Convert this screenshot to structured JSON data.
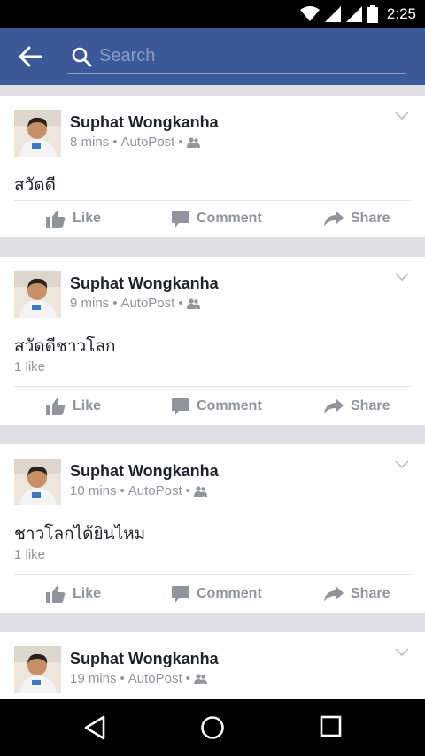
{
  "status": {
    "time": "2:25"
  },
  "search": {
    "placeholder": "Search"
  },
  "posts": [
    {
      "author": "Suphat Wongkanha",
      "time": "8 mins",
      "app": "AutoPost",
      "text": "สวัดดี",
      "likes": ""
    },
    {
      "author": "Suphat Wongkanha",
      "time": "9 mins",
      "app": "AutoPost",
      "text": "สวัดดีชาวโลก",
      "likes": "1 like"
    },
    {
      "author": "Suphat Wongkanha",
      "time": "10 mins",
      "app": "AutoPost",
      "text": "ชาวโลกได้ยินไหม",
      "likes": "1 like"
    },
    {
      "author": "Suphat Wongkanha",
      "time": "19 mins",
      "app": "AutoPost",
      "text": "",
      "likes": ""
    }
  ],
  "actions": {
    "like": "Like",
    "comment": "Comment",
    "share": "Share"
  },
  "separators": {
    "dot": "•"
  },
  "colors": {
    "brand": "#3b5998",
    "meta": "#90949c",
    "text": "#1d2129",
    "feed_bg": "#dddfe2"
  },
  "icons": [
    "back-arrow-icon",
    "search-icon",
    "chevron-down-icon",
    "friends-icon",
    "thumbs-up-icon",
    "comment-icon",
    "share-icon",
    "wifi-icon",
    "signal-icon",
    "battery-icon",
    "nav-back-icon",
    "nav-home-icon",
    "nav-recents-icon"
  ]
}
